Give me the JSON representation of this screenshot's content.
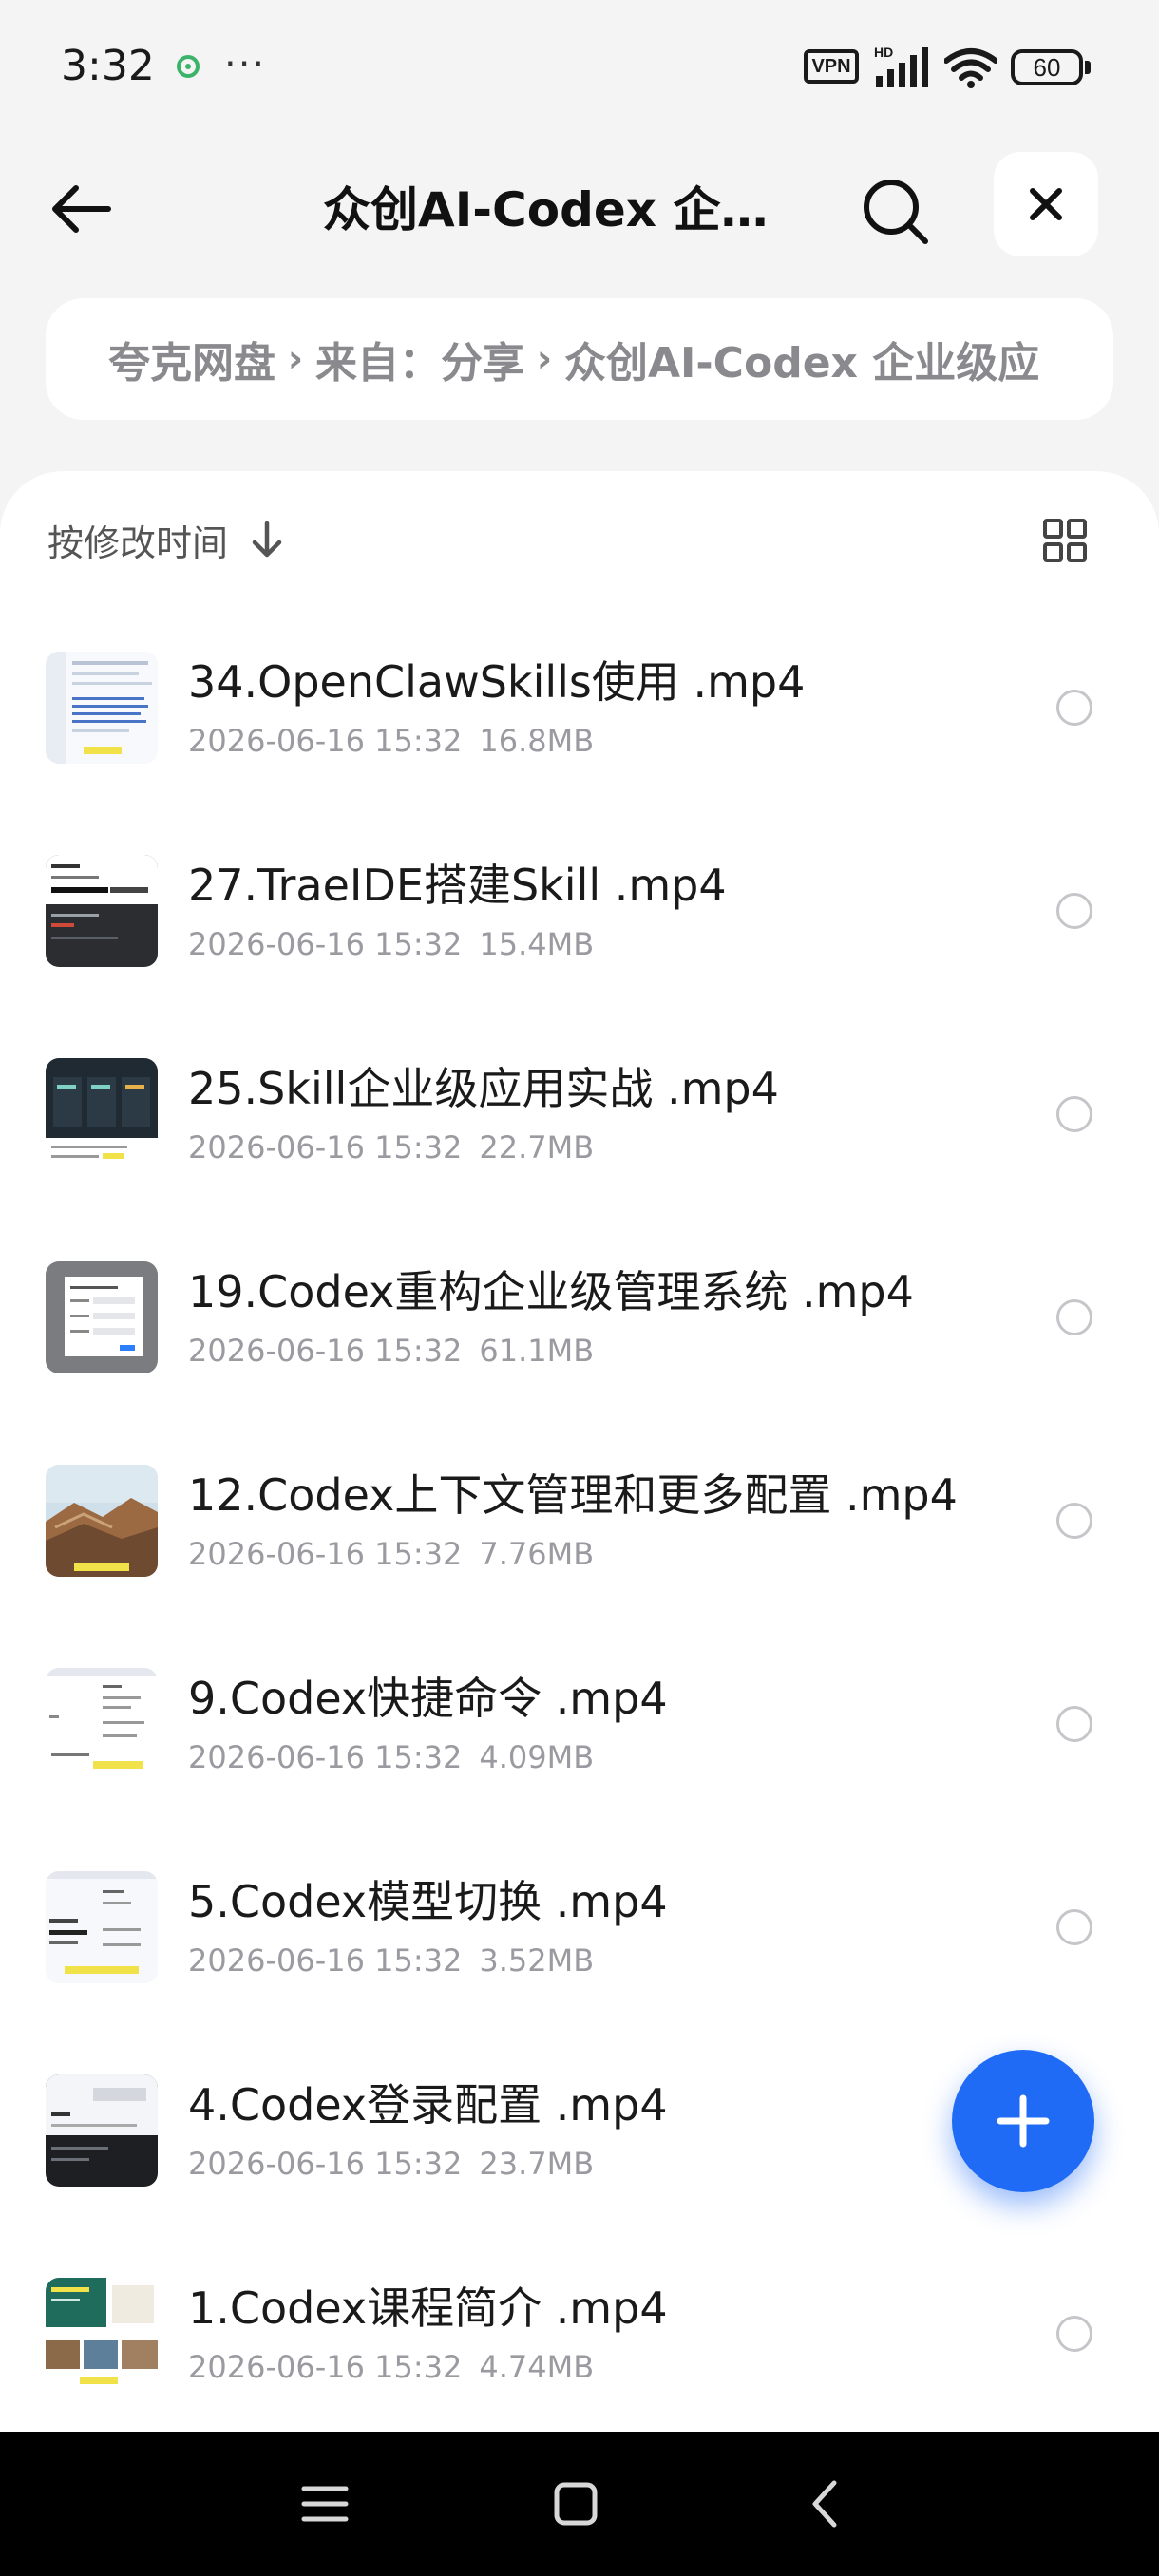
{
  "status_bar": {
    "time": "3:32",
    "more": "···",
    "vpn": "VPN",
    "battery": "60"
  },
  "header": {
    "title": "众创AI-Codex 企业...",
    "back_icon": "arrow-left-icon",
    "search_icon": "search-icon",
    "close_icon": "close-icon"
  },
  "breadcrumb": {
    "items": [
      "夸克网盘",
      "来自：分享",
      "众创AI-Codex 企业级应"
    ]
  },
  "toolbar": {
    "sort_label": "按修改时间",
    "sort_icon": "arrow-down-icon",
    "view_icon": "grid-view-icon"
  },
  "files": [
    {
      "name": "34.OpenClawSkills使用 .mp4",
      "date": "2026-06-16 15:32",
      "size": "16.8MB"
    },
    {
      "name": "27.TraeIDE搭建Skill .mp4",
      "date": "2026-06-16 15:32",
      "size": "15.4MB"
    },
    {
      "name": "25.Skill企业级应用实战 .mp4",
      "date": "2026-06-16 15:32",
      "size": "22.7MB"
    },
    {
      "name": "19.Codex重构企业级管理系统 .mp4",
      "date": "2026-06-16 15:32",
      "size": "61.1MB"
    },
    {
      "name": "12.Codex上下文管理和更多配置 .mp4",
      "date": "2026-06-16 15:32",
      "size": "7.76MB"
    },
    {
      "name": "9.Codex快捷命令 .mp4",
      "date": "2026-06-16 15:32",
      "size": "4.09MB"
    },
    {
      "name": "5.Codex模型切换 .mp4",
      "date": "2026-06-16 15:32",
      "size": "3.52MB"
    },
    {
      "name": "4.Codex登录配置 .mp4",
      "date": "2026-06-16 15:32",
      "size": "23.7MB"
    },
    {
      "name": "1.Codex课程简介 .mp4",
      "date": "2026-06-16 15:32",
      "size": "4.74MB"
    }
  ],
  "fab": {
    "icon": "plus-icon"
  },
  "nav_bar": {
    "menu_icon": "menu-icon",
    "home_icon": "home-icon",
    "back_icon": "back-chevron-icon"
  },
  "colors": {
    "accent": "#1f6bf5",
    "background": "#f4f4f5",
    "panel": "#ffffff",
    "secondary_text": "#9a9aa0"
  }
}
